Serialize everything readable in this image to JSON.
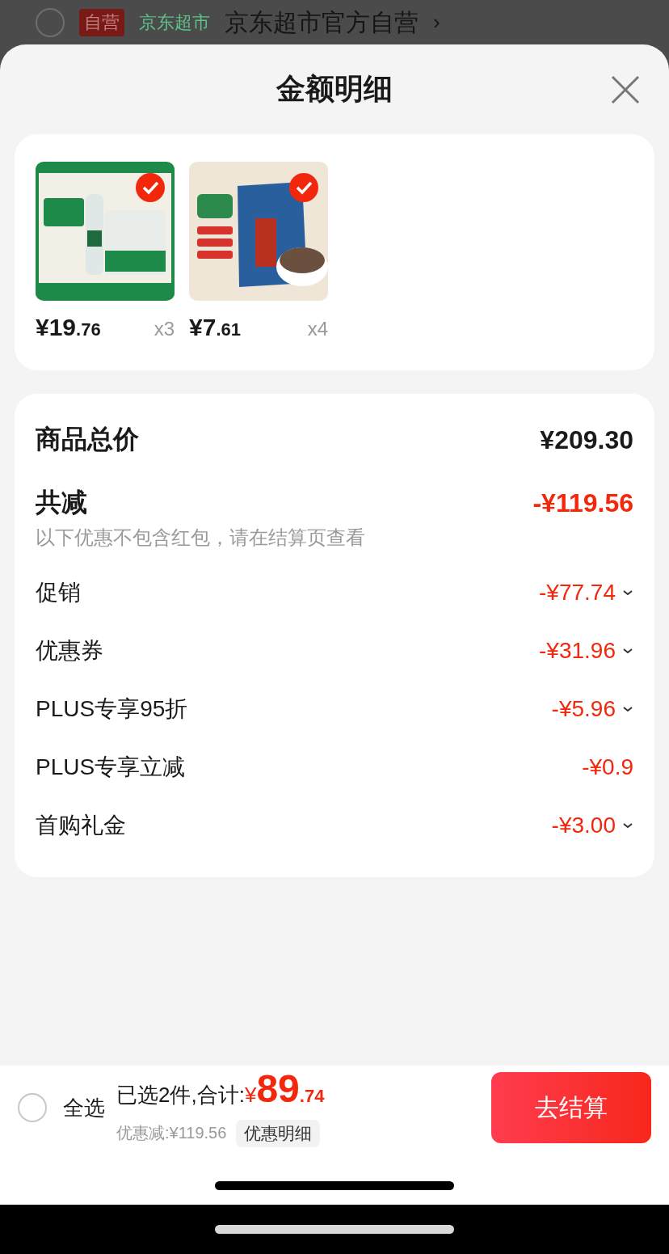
{
  "store_row": {
    "checked": false,
    "badge": "自营",
    "tag": "京东超市",
    "name": "京东超市官方自营",
    "arrow": "›"
  },
  "sheet": {
    "title": "金额明细"
  },
  "products": [
    {
      "kind": "picture",
      "selected": true,
      "price_int": "¥19",
      "price_dec": ".76",
      "qty": "x3"
    },
    {
      "kind": "picture",
      "selected": true,
      "price_int": "¥7",
      "price_dec": ".61",
      "qty": "x4"
    }
  ],
  "summary": {
    "total_label": "商品总价",
    "total_value": "¥209.30",
    "discount_label": "共减",
    "discount_value": "-¥119.56",
    "note": "以下优惠不包含红包，请在结算页查看"
  },
  "discounts": [
    {
      "label": "促销",
      "value": "-¥77.74",
      "expandable": true
    },
    {
      "label": "优惠券",
      "value": "-¥31.96",
      "expandable": true
    },
    {
      "label": "PLUS专享95折",
      "value": "-¥5.96",
      "expandable": true
    },
    {
      "label": "PLUS专享立减",
      "value": "-¥0.9",
      "expandable": false
    },
    {
      "label": "首购礼金",
      "value": "-¥3.00",
      "expandable": true
    }
  ],
  "bottom_bar": {
    "select_all_checked": false,
    "select_all": "全选",
    "selected_text": "已选2件,合计:",
    "currency": "¥",
    "total_int": "89",
    "total_dec": ".74",
    "saved": "优惠减:¥119.56",
    "detail_button": "优惠明细",
    "checkout": "去结算"
  }
}
